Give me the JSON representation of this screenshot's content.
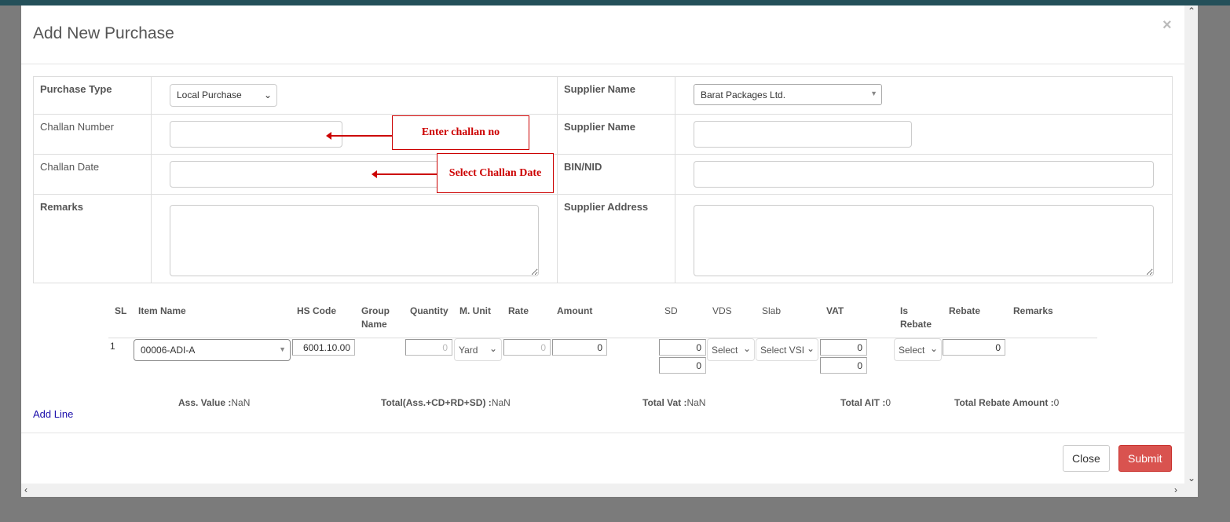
{
  "modal": {
    "title": "Add New Purchase",
    "close_icon": "times-icon"
  },
  "form": {
    "purchase_type_label": "Purchase Type",
    "purchase_type_value": "Local Purchase",
    "challan_number_label": "Challan Number",
    "challan_number_value": "",
    "challan_date_label": "Challan Date",
    "challan_date_value": "",
    "remarks_label": "Remarks",
    "remarks_value": "",
    "supplier_name_label": "Supplier Name",
    "supplier_name_value": "Barat Packages Ltd.",
    "supplier_name2_label": "Supplier Name",
    "supplier_name2_value": "",
    "bin_label": "BIN/NID",
    "bin_value": "",
    "supplier_address_label": "Supplier Address",
    "supplier_address_value": ""
  },
  "annotations": {
    "challan_no": "Enter challan no",
    "challan_date": "Select Challan Date",
    "color": "#cc0000"
  },
  "lines": {
    "headers": {
      "sl": "SL",
      "item": "Item Name",
      "hs": "HS Code",
      "group1": "Group",
      "group2": "Name",
      "qty": "Quantity",
      "unit": "M. Unit",
      "rate": "Rate",
      "amount": "Amount",
      "sd": "SD",
      "vds": "VDS",
      "slab": "Slab",
      "vat": "VAT",
      "isreb1": "Is",
      "isreb2": "Rebate",
      "rebate": "Rebate",
      "remarks": "Remarks"
    },
    "rows": [
      {
        "sl": "1",
        "item": "00006-ADI-A",
        "hs": "6001.10.00",
        "qty": "0",
        "unit": "Yard",
        "rate": "0",
        "amount": "0",
        "sd": "0",
        "sd2": "0",
        "vds": "Select",
        "slab": "Select VSI",
        "vat": "0",
        "vat2": "0",
        "is_rebate": "Select",
        "rebate": "0"
      }
    ]
  },
  "totals": {
    "ass_label": "Ass. Value :",
    "ass": "NaN",
    "total_label": "Total(Ass.+CD+RD+SD) :",
    "total": "NaN",
    "vat_label": "Total Vat :",
    "vat": "NaN",
    "ait_label": "Total AIT :",
    "ait": "0",
    "rebate_label": "Total Rebate Amount :",
    "rebate": "0"
  },
  "add_line": "Add Line",
  "footer": {
    "close": "Close",
    "submit": "Submit",
    "submit_color": "#d9534f"
  }
}
